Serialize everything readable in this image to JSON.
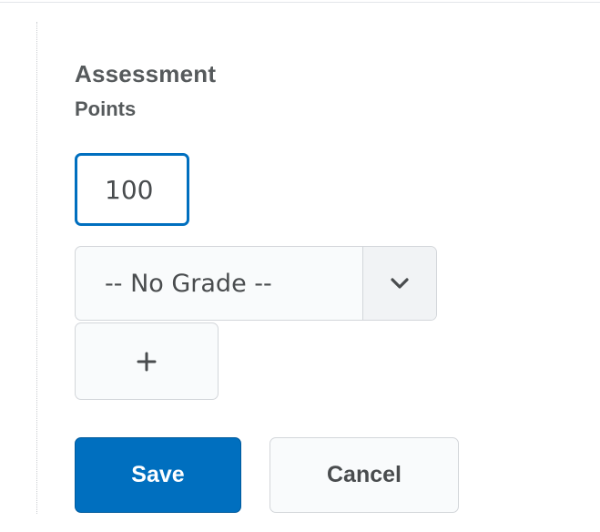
{
  "section": {
    "title": "Assessment",
    "subtitle": "Points"
  },
  "points_input": {
    "value": "100"
  },
  "grade_select": {
    "selected": "-- No Grade --",
    "icon": "chevron-down-icon"
  },
  "add_button": {
    "label": "+",
    "icon": "plus-icon"
  },
  "actions": {
    "save_label": "Save",
    "cancel_label": "Cancel"
  },
  "colors": {
    "primary": "#006fbf",
    "border": "#d3d6da",
    "text": "#494c4e"
  }
}
